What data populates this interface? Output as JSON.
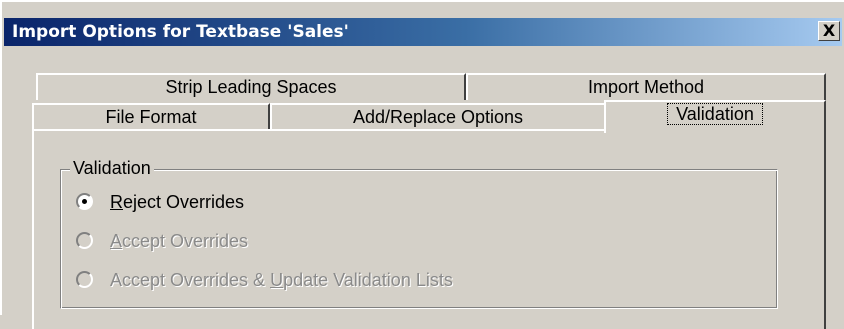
{
  "window": {
    "title": "Import Options for Textbase 'Sales'",
    "close_label": "X"
  },
  "tabs": {
    "row_back": [
      {
        "label": "Strip Leading Spaces"
      },
      {
        "label": "Import Method"
      }
    ],
    "row_front": [
      {
        "label": "File Format"
      },
      {
        "label": "Add/Replace Options"
      },
      {
        "label": "Validation",
        "selected": true
      }
    ]
  },
  "validation_group": {
    "title": "Validation",
    "options": [
      {
        "pre": "",
        "accel": "R",
        "post": "eject Overrides",
        "checked": true,
        "enabled": true
      },
      {
        "pre": "",
        "accel": "A",
        "post": "ccept Overrides",
        "checked": false,
        "enabled": false
      },
      {
        "pre": "Accept Overrides & ",
        "accel": "U",
        "post": "pdate Validation Lists",
        "checked": false,
        "enabled": false
      }
    ]
  },
  "colors": {
    "title_start": "#0a246a",
    "title_end": "#a6caf0",
    "face": "#d4d0c8",
    "disabled_text": "#8a8a8a"
  }
}
